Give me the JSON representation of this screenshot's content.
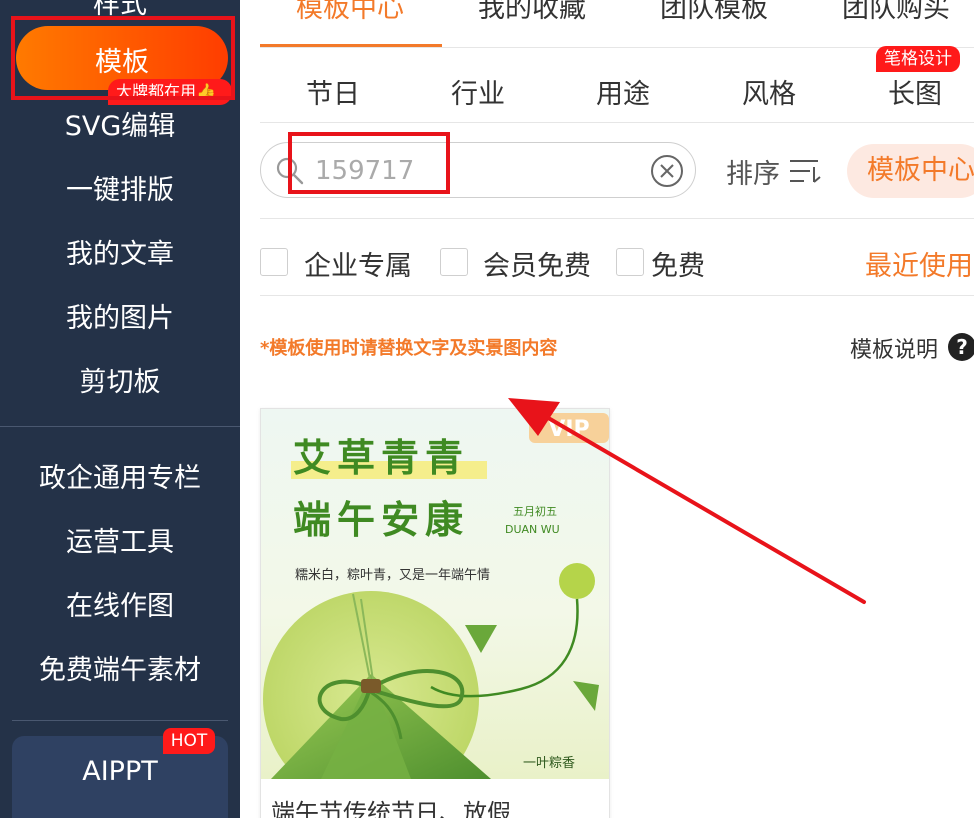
{
  "sidebar": {
    "partial_top_label": "样式",
    "active_item": {
      "label": "模板",
      "badge": "大牌都在用👍"
    },
    "items": [
      "SVG编辑",
      "一键排版",
      "我的文章",
      "我的图片",
      "剪切板"
    ],
    "section2": [
      "政企通用专栏",
      "运营工具",
      "在线作图",
      "免费端午素材"
    ],
    "aippt": {
      "label": "AIPPT",
      "badge": "HOT"
    }
  },
  "top_tabs": [
    "模板中心",
    "我的收藏",
    "团队模板",
    "团队购买"
  ],
  "categories": [
    "节日",
    "行业",
    "用途",
    "风格",
    "长图"
  ],
  "category_badge": "笔格设计",
  "search": {
    "value": "159717",
    "placeholder": ""
  },
  "sort_label": "排序",
  "template_center_button": "模板中心",
  "filters": [
    "企业专属",
    "会员免费",
    "免费"
  ],
  "recent_label": "最近使用",
  "notice": "*模板使用时请替换文字及实景图内容",
  "help_label": "模板说明",
  "help_icon_glyph": "?",
  "card": {
    "badge": "VIP",
    "headline1": "艾草青青",
    "headline2": "端午安康",
    "date_cn": "五月初五",
    "date_en": "DUAN WU",
    "subline": "糯米白，粽叶青，又是一年端午情",
    "brand": "一叶粽香",
    "title": "端午节传统节日、放假..."
  },
  "colors": {
    "accent": "#f37a2a",
    "sidebar_bg": "#243248",
    "annotation_red": "#e8131a"
  }
}
